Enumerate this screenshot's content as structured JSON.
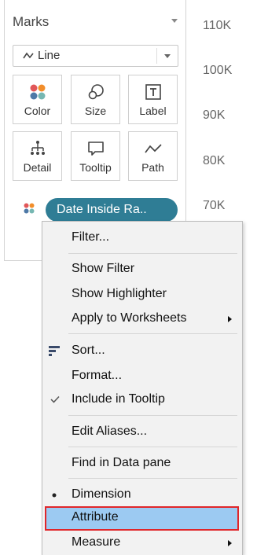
{
  "marks": {
    "title": "Marks",
    "mark_type": "Line",
    "tiles": [
      {
        "label": "Color",
        "icon": "color-dots-icon"
      },
      {
        "label": "Size",
        "icon": "size-rings-icon"
      },
      {
        "label": "Label",
        "icon": "label-t-icon"
      },
      {
        "label": "Detail",
        "icon": "detail-tree-icon"
      },
      {
        "label": "Tooltip",
        "icon": "tooltip-bubble-icon"
      },
      {
        "label": "Path",
        "icon": "path-line-icon"
      }
    ],
    "field_pill": "Date Inside Ra.."
  },
  "axis": {
    "ticks": [
      "110K",
      "100K",
      "90K",
      "80K",
      "70K"
    ]
  },
  "context_menu": {
    "items": {
      "filter": "Filter...",
      "show_filter": "Show Filter",
      "show_highlighter": "Show Highlighter",
      "apply_to_worksheets": "Apply to Worksheets",
      "sort": "Sort...",
      "format": "Format...",
      "include_in_tooltip": "Include in Tooltip",
      "edit_aliases": "Edit Aliases...",
      "find_in_data_pane": "Find in Data pane",
      "dimension": "Dimension",
      "attribute": "Attribute",
      "measure": "Measure"
    }
  },
  "colors": {
    "pill": "#2f7d95",
    "highlight": "#9ccaf2",
    "highlight_border": "#e0262a"
  }
}
